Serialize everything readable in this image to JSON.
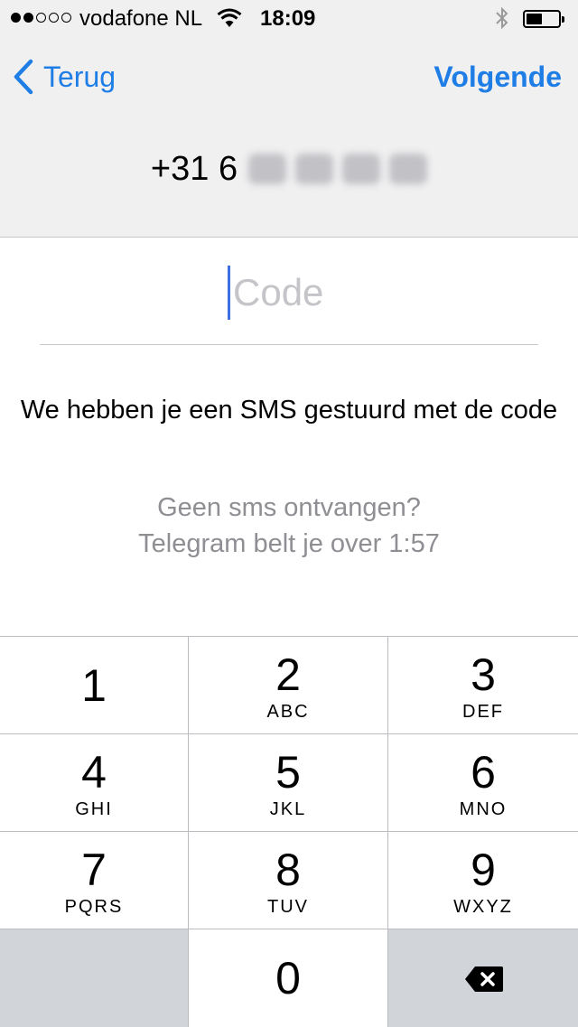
{
  "status_bar": {
    "signal_filled": 2,
    "signal_total": 5,
    "carrier": "vodafone NL",
    "time": "18:09",
    "icons": [
      "wifi-icon",
      "bluetooth-icon",
      "battery-icon"
    ],
    "battery_level": 0.5
  },
  "nav": {
    "back_label": "Terug",
    "next_label": "Volgende",
    "accent_color": "#1f7ee6"
  },
  "phone": {
    "visible_prefix": "+31 6"
  },
  "code_field": {
    "placeholder": "Code",
    "value": ""
  },
  "info_text": "We hebben je een SMS gestuurd met de code",
  "resend": {
    "line1": "Geen sms ontvangen?",
    "line2": "Telegram belt je over 1:57"
  },
  "keypad": {
    "keys": [
      {
        "digit": "1",
        "letters": ""
      },
      {
        "digit": "2",
        "letters": "ABC"
      },
      {
        "digit": "3",
        "letters": "DEF"
      },
      {
        "digit": "4",
        "letters": "GHI"
      },
      {
        "digit": "5",
        "letters": "JKL"
      },
      {
        "digit": "6",
        "letters": "MNO"
      },
      {
        "digit": "7",
        "letters": "PQRS"
      },
      {
        "digit": "8",
        "letters": "TUV"
      },
      {
        "digit": "9",
        "letters": "WXYZ"
      },
      {
        "digit": "0",
        "letters": ""
      }
    ],
    "delete_icon": "backspace-icon"
  }
}
